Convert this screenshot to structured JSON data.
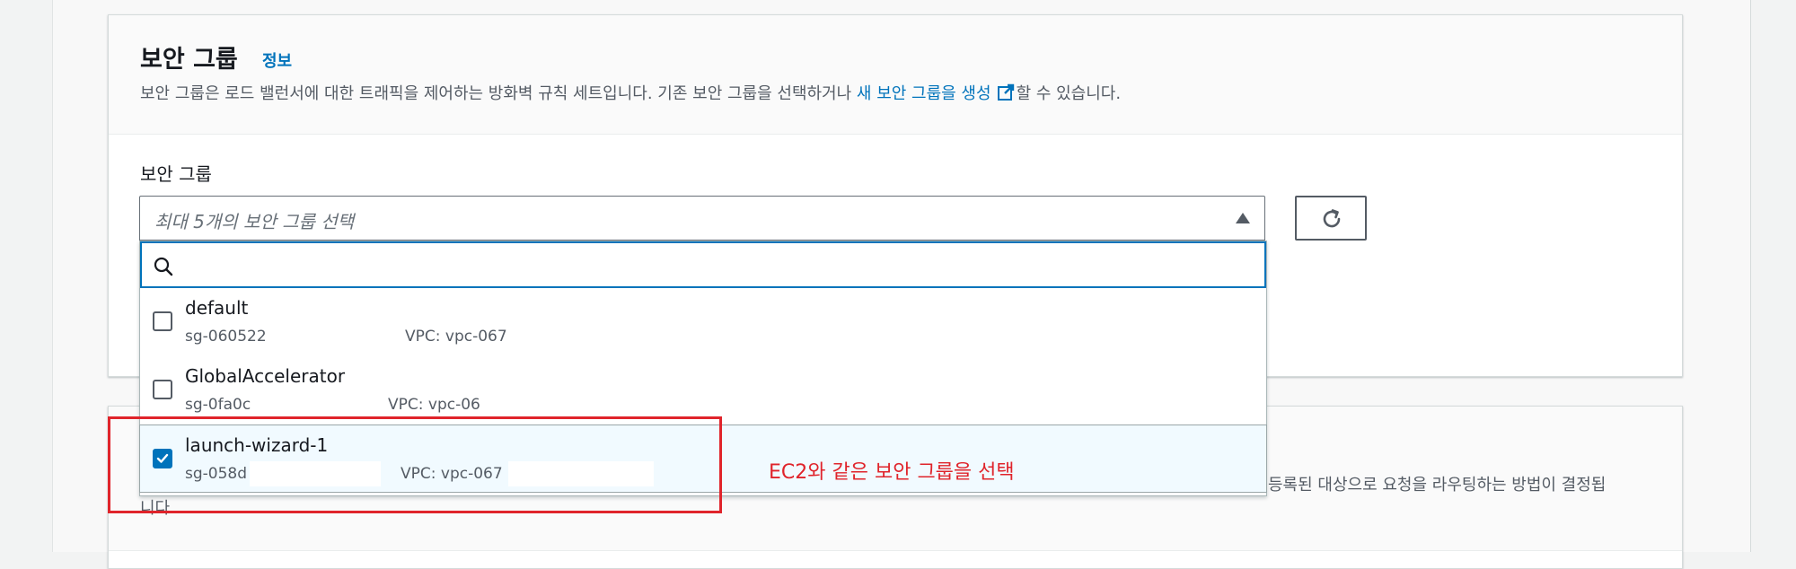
{
  "section": {
    "title": "보안 그룹",
    "info_link": "정보",
    "description": "보안 그룹은 로드 밸런서에 대한 트래픽을 제어하는 방화벽 규칙 세트입니다. 기존 보안 그룹을 선택하거나 ",
    "description_link": "새 보안 그룹을 생성",
    "description_tail": "할 수 있습니다."
  },
  "field": {
    "label": "보안 그룹",
    "placeholder": "최대 5개의 보안 그룹 선택",
    "search_value": ""
  },
  "options": [
    {
      "name": "default",
      "sg": "sg-060522",
      "vpc": "VPC: vpc-067",
      "checked": false
    },
    {
      "name": "GlobalAccelerator",
      "sg": "sg-0fa0c",
      "vpc": "VPC: vpc-06",
      "checked": false
    },
    {
      "name": "launch-wizard-1",
      "sg": "sg-058d",
      "vpc": "VPC: vpc-067",
      "checked": true
    }
  ],
  "bottom_panel": {
    "description_tail": "등록된 대상으로 요청을 라우팅하는 방법이 결정됩",
    "description_wrap": "니다."
  },
  "annotation": {
    "text": "EC2와 같은 보안 그룹을 선택",
    "color": "#e0242b"
  },
  "colors": {
    "link": "#0073bb",
    "checkbox_checked": "#0073bb",
    "selected_row": "#f1faff"
  },
  "icons": {
    "external_link": "external-link-icon",
    "caret": "caret-up-icon",
    "refresh": "refresh-icon",
    "search": "search-icon"
  }
}
